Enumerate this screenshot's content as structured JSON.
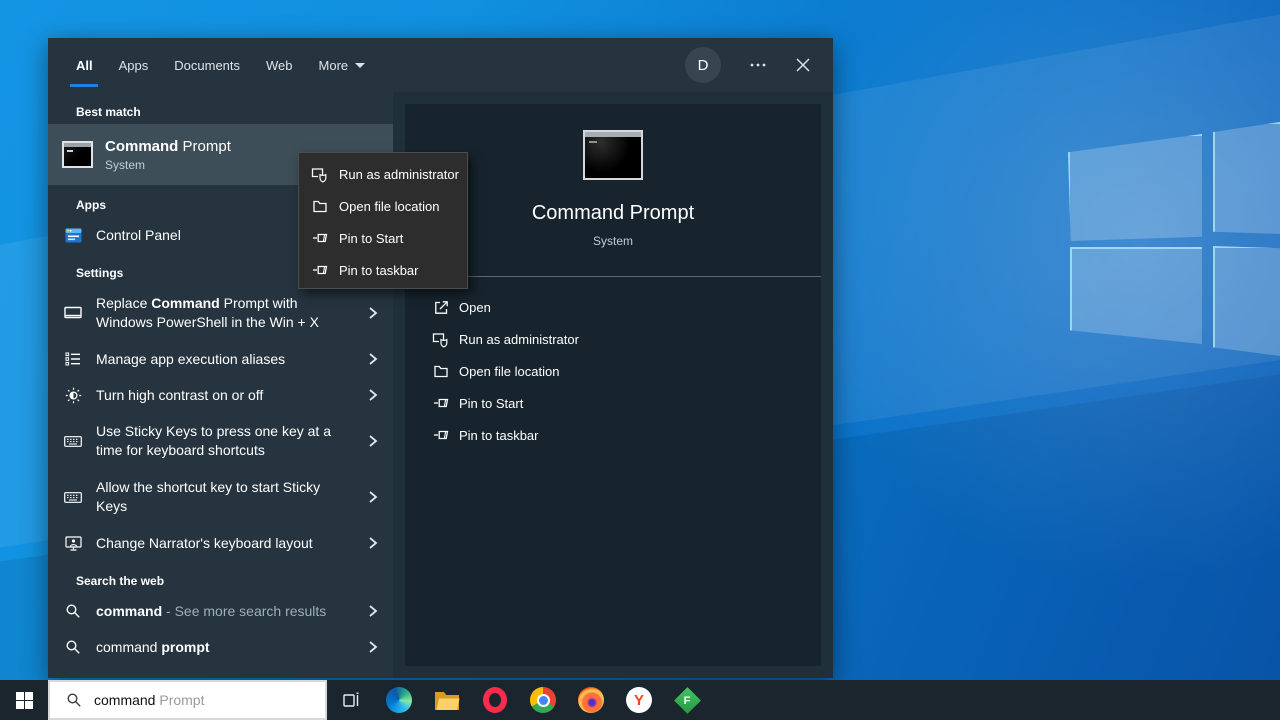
{
  "colors": {
    "accent": "#1a86e0",
    "flyout_bg": "#25343f",
    "row_highlight": "#3e4e59",
    "right_panel": "#20303b",
    "preview_pane": "#17242e",
    "context_menu_bg": "#2d2d2d",
    "taskbar_bg": "#1a252e",
    "wallpaper_blue": "#0d7ad0"
  },
  "flyout": {
    "tabs": [
      {
        "label": "All",
        "active": true
      },
      {
        "label": "Apps",
        "active": false
      },
      {
        "label": "Documents",
        "active": false
      },
      {
        "label": "Web",
        "active": false
      },
      {
        "label": "More",
        "active": false,
        "icon": "chevron-down-icon"
      }
    ],
    "avatar_initial": "D",
    "headers": {
      "best_match": "Best match",
      "apps": "Apps",
      "settings": "Settings",
      "search_web": "Search the web"
    },
    "best_match": {
      "icon": "command-prompt-icon",
      "title_bold": "Command",
      "title_rest": " Prompt",
      "subtitle": "System"
    },
    "apps_items": [
      {
        "icon": "control-panel-icon",
        "label": "Control Panel"
      }
    ],
    "settings_items": [
      {
        "icon": "display-icon",
        "pre": "Replace ",
        "bold": "Command",
        "post": " Prompt with Windows PowerShell in the Win + X"
      },
      {
        "icon": "list-icon",
        "label": "Manage app execution aliases"
      },
      {
        "icon": "contrast-icon",
        "label": "Turn high contrast on or off"
      },
      {
        "icon": "keyboard-icon",
        "label": "Use Sticky Keys to press one key at a time for keyboard shortcuts"
      },
      {
        "icon": "keyboard-icon",
        "label": "Allow the shortcut key to start Sticky Keys"
      },
      {
        "icon": "narrator-icon",
        "label": "Change Narrator's keyboard layout"
      }
    ],
    "search_web_items": [
      {
        "icon": "search-icon",
        "bold": "command",
        "rest": " - See more search results"
      },
      {
        "icon": "search-icon",
        "pre": "command ",
        "bold": "prompt"
      }
    ]
  },
  "context_menu": {
    "items": [
      {
        "icon": "run-as-admin-icon",
        "label": "Run as administrator"
      },
      {
        "icon": "folder-icon",
        "label": "Open file location"
      },
      {
        "icon": "pin-icon",
        "label": "Pin to Start"
      },
      {
        "icon": "pin-icon",
        "label": "Pin to taskbar"
      }
    ]
  },
  "preview": {
    "icon": "command-prompt-icon-large",
    "title": "Command Prompt",
    "subtitle": "System",
    "actions": [
      {
        "icon": "open-icon",
        "label": "Open"
      },
      {
        "icon": "run-as-admin-icon",
        "label": "Run as administrator"
      },
      {
        "icon": "folder-icon",
        "label": "Open file location"
      },
      {
        "icon": "pin-icon",
        "label": "Pin to Start"
      },
      {
        "icon": "pin-icon",
        "label": "Pin to taskbar"
      }
    ]
  },
  "taskbar": {
    "search_typed": "command",
    "search_suggestion": "Prompt",
    "apps": [
      "task-view",
      "edge",
      "file-explorer",
      "opera",
      "chrome",
      "firefox",
      "yandex-browser",
      "green-diamond-app"
    ],
    "yandex_letter": "Y",
    "diamond_letter": "F"
  }
}
